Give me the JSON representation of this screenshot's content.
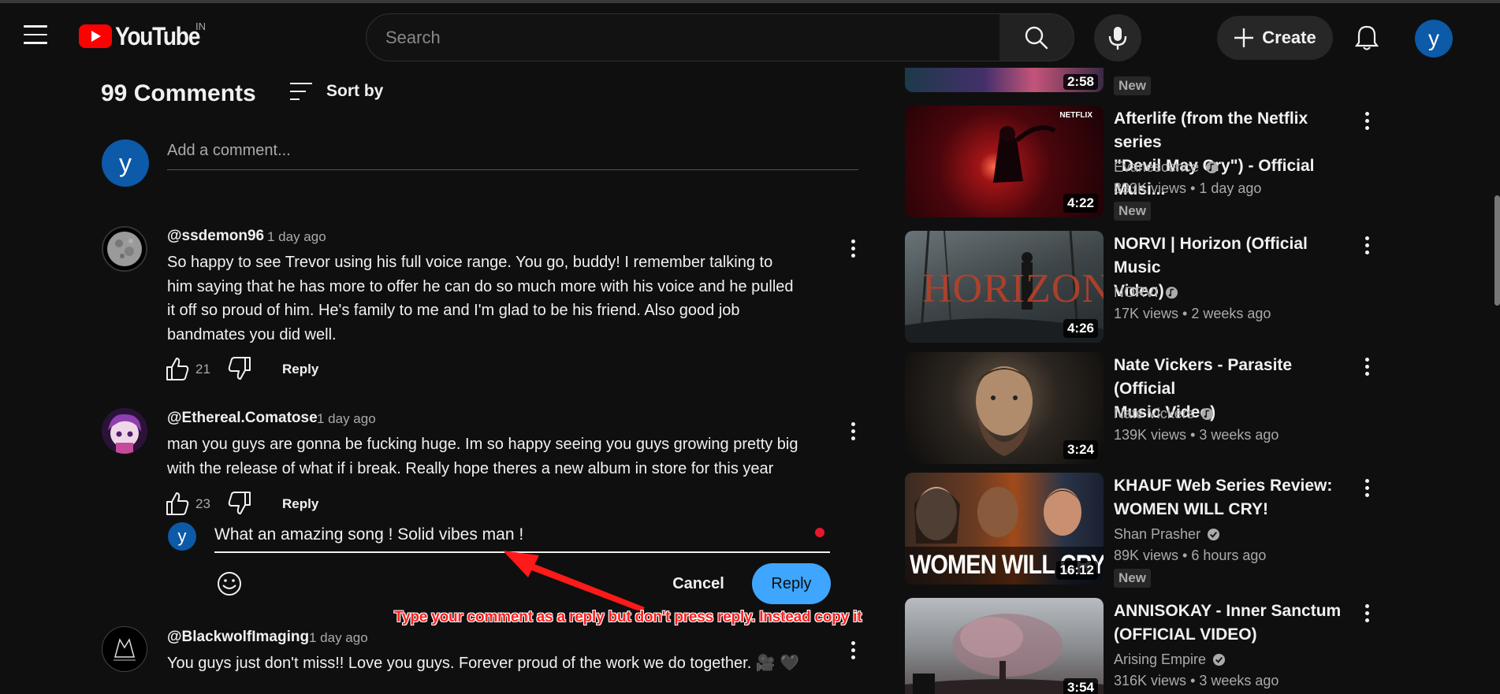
{
  "header": {
    "logo_text": "YouTube",
    "region": "IN",
    "search_placeholder": "Search",
    "create_label": "Create",
    "avatar_letter": "y"
  },
  "comments": {
    "count_label": "99 Comments",
    "sort_label": "Sort by",
    "add_placeholder": "Add a comment...",
    "user_avatar_letter": "y",
    "reply_label": "Reply",
    "items": [
      {
        "author": "@ssdemon96",
        "time": "1 day ago",
        "lines": [
          "So happy to see Trevor using his full voice range.  You go, buddy! I remember talking to",
          "him saying that he has more to offer he can do so much more with his voice and he pulled",
          "it off so proud of him. He's family to me and I'm glad to be his friend. Also good job",
          "bandmates you did well."
        ],
        "likes": "21"
      },
      {
        "author": "@Ethereal.Comatose",
        "time": "1 day ago",
        "lines": [
          "man you guys are gonna be fucking huge. Im so happy seeing you guys growing pretty big",
          "with the release of what if i break. Really hope theres a new album in store for this year"
        ],
        "likes": "23"
      },
      {
        "author": "@BlackwolfImaging",
        "time": "1 day ago",
        "lines": [
          "You guys just don't miss!! Love you guys. Forever proud of the work we do together. 🎥 🖤"
        ]
      }
    ],
    "reply_box": {
      "avatar_letter": "y",
      "value": "What an amazing song ! Solid vibes man !",
      "cancel_label": "Cancel",
      "submit_label": "Reply"
    },
    "annotation": "Type your comment as a reply but don't press reply. Instead copy it"
  },
  "sidebar": {
    "top_partial": {
      "duration": "2:58",
      "badge": "New"
    },
    "videos": [
      {
        "title_lines": [
          "Afterlife (from the Netflix series",
          "\"Devil May Cry\") - Official Musi..."
        ],
        "channel": "Evanescence",
        "views": "833K views",
        "age": "1 day ago",
        "duration": "4:22",
        "badge": "New",
        "thumb_label": "NETFLIX"
      },
      {
        "title_lines": [
          "NORVI | Horizon (Official Music",
          "Video)"
        ],
        "channel": "NORVI",
        "views": "17K views",
        "age": "2 weeks ago",
        "duration": "4:26",
        "thumb_label": "HORIZON"
      },
      {
        "title_lines": [
          "Nate Vickers - Parasite (Official",
          "Music Video)"
        ],
        "channel": "Nate Vickers",
        "views": "139K views",
        "age": "3 weeks ago",
        "duration": "3:24"
      },
      {
        "title_lines": [
          "KHAUF Web Series Review:",
          "WOMEN WILL CRY!"
        ],
        "channel": "Shan Prasher",
        "views": "89K views",
        "age": "6 hours ago",
        "duration": "16:12",
        "badge": "New",
        "thumb_label": "WOMEN WILL CRY"
      },
      {
        "title_lines": [
          "ANNISOKAY - Inner Sanctum",
          "(OFFICIAL VIDEO)"
        ],
        "channel": "Arising Empire",
        "views": "316K views",
        "age": "3 weeks ago",
        "duration": "3:54"
      }
    ]
  }
}
